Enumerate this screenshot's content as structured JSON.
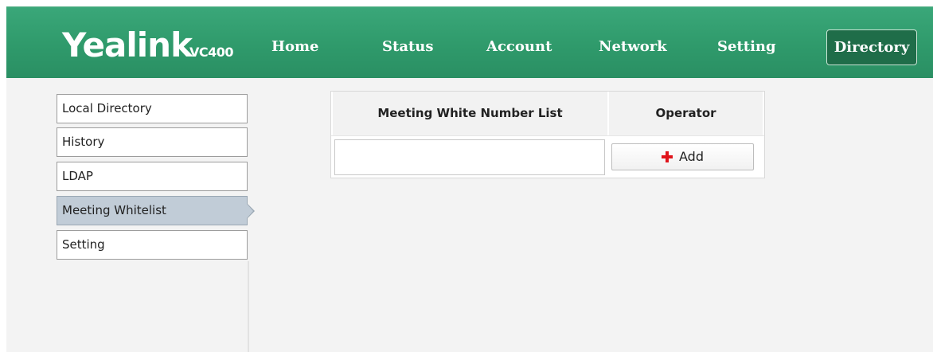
{
  "brand": {
    "logo_text": "Yealink",
    "model": "VC400"
  },
  "nav": {
    "items": [
      {
        "label": "Home"
      },
      {
        "label": "Status"
      },
      {
        "label": "Account"
      },
      {
        "label": "Network"
      },
      {
        "label": "Setting"
      },
      {
        "label": "Directory"
      }
    ],
    "active": "Directory"
  },
  "sidebar": {
    "items": [
      {
        "label": "Local Directory"
      },
      {
        "label": "History"
      },
      {
        "label": "LDAP"
      },
      {
        "label": "Meeting Whitelist"
      },
      {
        "label": "Setting"
      }
    ],
    "selected": "Meeting Whitelist"
  },
  "main": {
    "table": {
      "headers": [
        "Meeting White Number List",
        "Operator"
      ],
      "input_value": "",
      "add_label": "Add"
    }
  },
  "colors": {
    "header_green": "#2f9a6b",
    "active_tab": "#1f6d49",
    "selected_sidebar": "#c1ccd7",
    "add_icon_red": "#e0141b"
  },
  "icons": {
    "add": "plus-icon",
    "selection_pointer": "caret-right-icon"
  }
}
